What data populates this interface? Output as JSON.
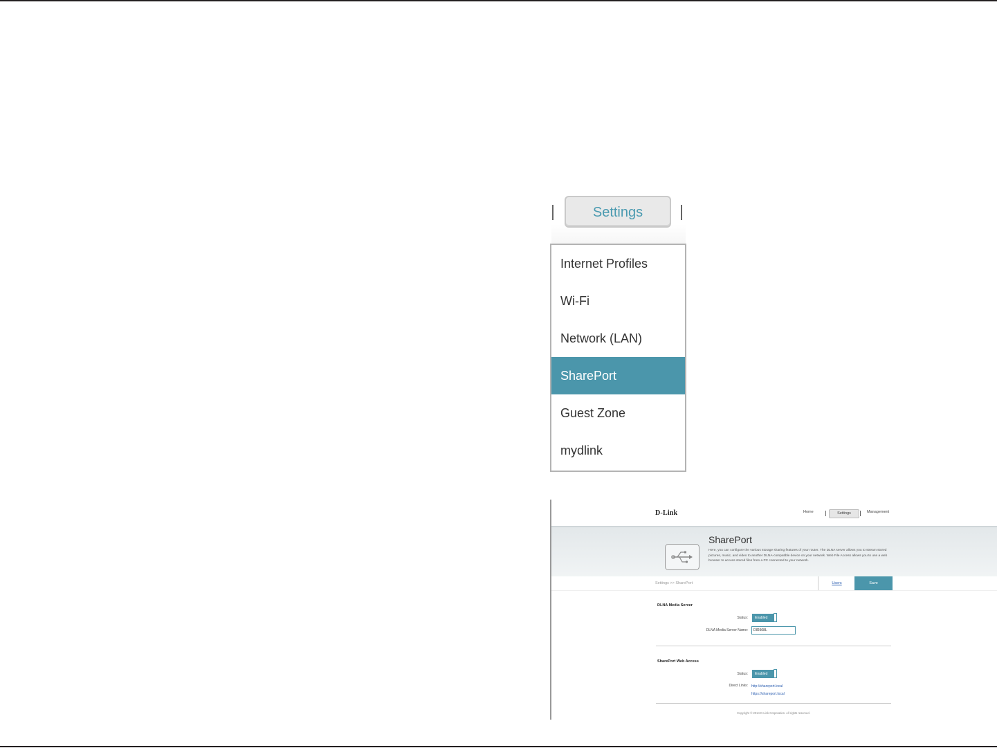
{
  "settings_tab": {
    "label": "Settings"
  },
  "dropdown": {
    "items": [
      {
        "label": "Internet Profiles"
      },
      {
        "label": "Wi-Fi"
      },
      {
        "label": "Network (LAN)"
      },
      {
        "label": "SharePort",
        "active": true
      },
      {
        "label": "Guest Zone"
      },
      {
        "label": "mydlink"
      }
    ]
  },
  "screenshot": {
    "logo": "D-Link",
    "nav": {
      "home": "Home",
      "settings": "Settings",
      "management": "Management"
    },
    "banner": {
      "title": "SharePort",
      "description": "Here, you can configure the various storage sharing features of your router. The DLNA server allows you to stream stored pictures, music, and video to another DLNA-compatible device on your network. Web File Access allows you to use a web browser to access stored files from a PC connected to your network."
    },
    "breadcrumb": "Settings >> SharePort",
    "users_label": "Users",
    "save_label": "Save",
    "dlna": {
      "heading": "DLNA Media Server",
      "status_label": "Status:",
      "status_value": "Enabled",
      "name_label": "DLNA Media Server Name:",
      "name_value": "DIR508L"
    },
    "web_access": {
      "heading": "SharePort Web Access",
      "status_label": "Status:",
      "status_value": "Enabled",
      "links_label": "Direct Links:",
      "link_http": "http://shareport.local",
      "link_https": "https://shareport.local"
    },
    "copyright": "Copyright © 2014 D-Link Corporation. All rights reserved."
  },
  "colors": {
    "accent": "#4b96ab",
    "tab_text": "#4a9ab0",
    "link": "#2a5db0"
  }
}
